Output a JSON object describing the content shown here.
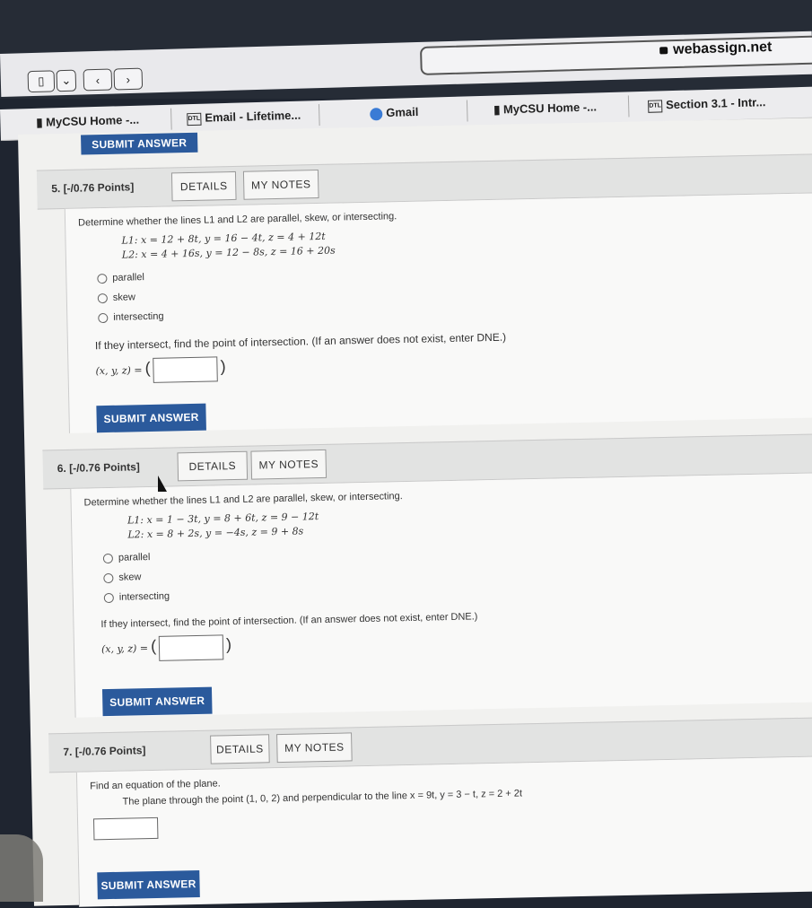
{
  "browser": {
    "url": "webassign.net",
    "bookmarks": [
      "MyCSU Home -...",
      "Email - Lifetime...",
      "Gmail",
      "MyCSU Home -...",
      "Section 3.1 - Intr..."
    ],
    "bookmark_icon_text": "DTL"
  },
  "top_submit": "SUBMIT ANSWER",
  "questions": [
    {
      "number": "5. [-/0.76 Points]",
      "details": "DETAILS",
      "notes": "MY NOTES",
      "prompt": "Determine whether the lines L1 and L2 are parallel, skew, or intersecting.",
      "line1": "L1: x = 12 + 8t, y = 16 − 4t, z = 4 + 12t",
      "line2": "L2: x = 4 + 16s, y = 12 − 8s, z = 16 + 20s",
      "options": [
        "parallel",
        "skew",
        "intersecting"
      ],
      "instruction": "If they intersect, find the point of intersection. (If an answer does not exist, enter DNE.)",
      "answer_label": "(x, y, z) =",
      "open_paren": "(",
      "close_paren": ")",
      "submit": "SUBMIT ANSWER"
    },
    {
      "number": "6. [-/0.76 Points]",
      "details": "DETAILS",
      "notes": "MY NOTES",
      "prompt": "Determine whether the lines L1 and L2 are parallel, skew, or intersecting.",
      "line1": "L1: x = 1 − 3t, y = 8 + 6t, z = 9 − 12t",
      "line2": "L2: x = 8 + 2s, y = −4s, z = 9 + 8s",
      "options": [
        "parallel",
        "skew",
        "intersecting"
      ],
      "instruction": "If they intersect, find the point of intersection. (If an answer does not exist, enter DNE.)",
      "answer_label": "(x, y, z) =",
      "open_paren": "(",
      "close_paren": ")",
      "submit": "SUBMIT ANSWER"
    },
    {
      "number": "7. [-/0.76 Points]",
      "details": "DETAILS",
      "notes": "MY NOTES",
      "prompt": "Find an equation of the plane.",
      "subprompt": "The plane through the point (1, 0, 2) and perpendicular to the line x = 9t, y = 3 − t, z = 2 + 2t",
      "submit": "SUBMIT ANSWER"
    }
  ]
}
